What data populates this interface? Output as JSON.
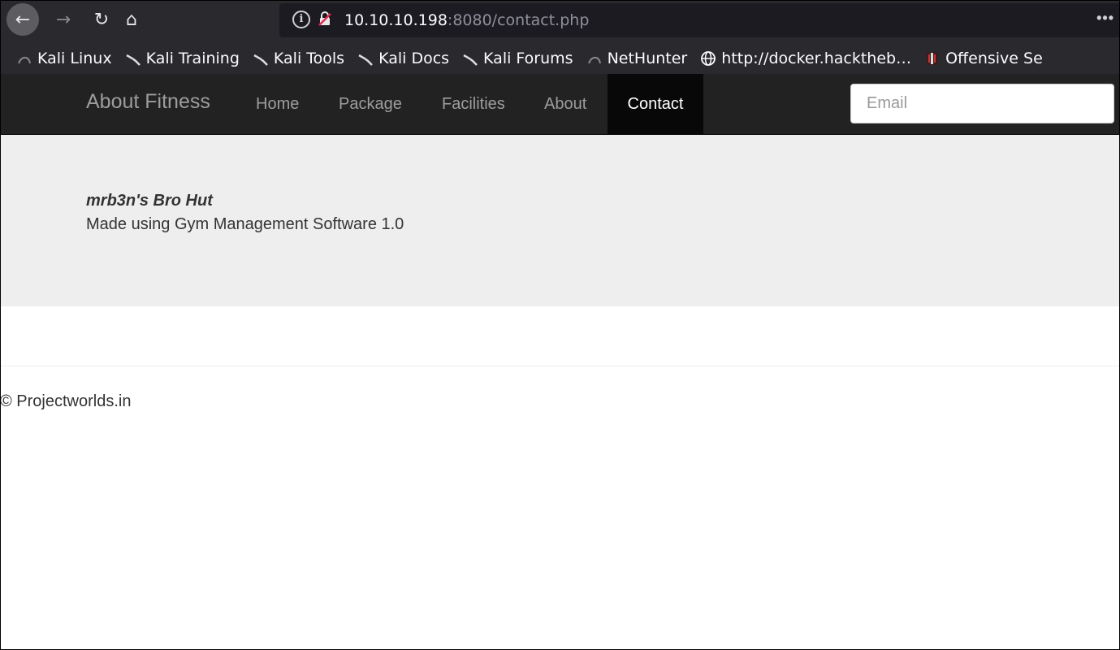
{
  "browser": {
    "url_host": "10.10.10.198",
    "url_rest": ":8080/contact.php",
    "icons": [
      "back-arrow-icon",
      "forward-arrow-icon",
      "reload-icon",
      "home-icon",
      "info-icon",
      "insecure-lock-icon",
      "more-icon"
    ],
    "bookmarks": [
      {
        "label": "Kali Linux",
        "icon": "kali-dragon-icon"
      },
      {
        "label": "Kali Training",
        "icon": "kali-icon"
      },
      {
        "label": "Kali Tools",
        "icon": "kali-icon"
      },
      {
        "label": "Kali Docs",
        "icon": "kali-icon"
      },
      {
        "label": "Kali Forums",
        "icon": "kali-icon"
      },
      {
        "label": "NetHunter",
        "icon": "kali-dragon-icon"
      },
      {
        "label": "http://docker.hacktheb…",
        "icon": "globe-icon"
      },
      {
        "label": "Offensive Se",
        "icon": "offsec-icon"
      }
    ]
  },
  "site_nav": {
    "brand": "About Fitness",
    "links": [
      "Home",
      "Package",
      "Facilities",
      "About",
      "Contact"
    ],
    "active_link": "Contact",
    "email_placeholder": "Email"
  },
  "jumbotron": {
    "title": "mrb3n's Bro Hut",
    "subtitle": "Made using Gym Management Software 1.0"
  },
  "footer": {
    "text": "© Projectworlds.in"
  }
}
